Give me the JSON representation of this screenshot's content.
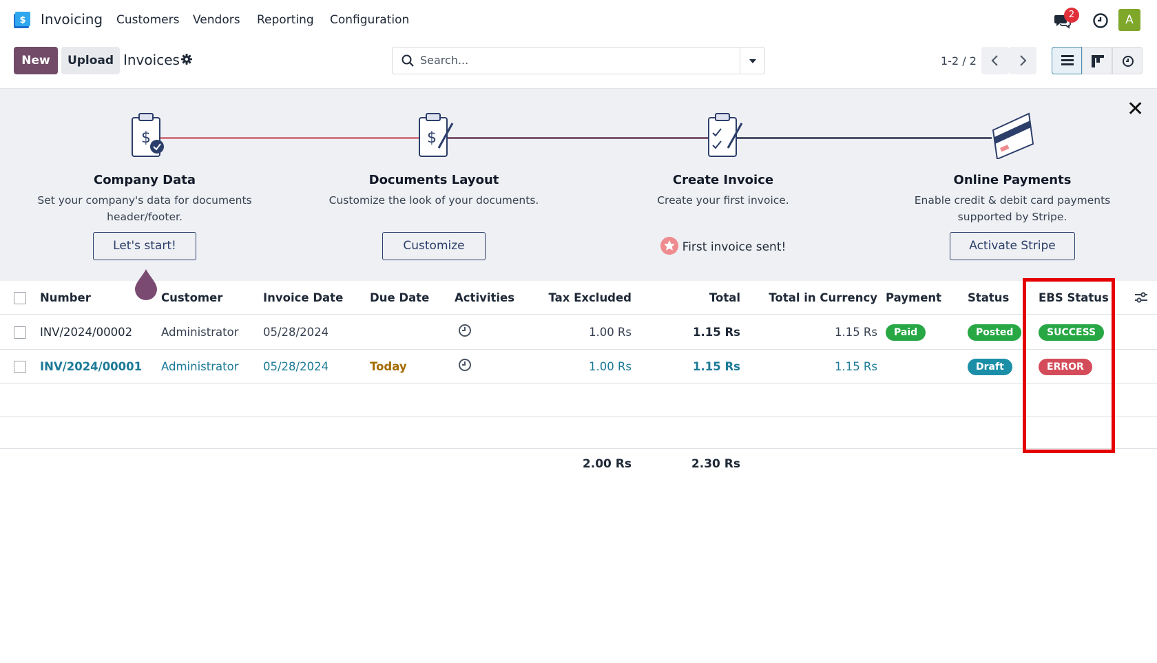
{
  "app": {
    "name": "Invoicing",
    "menu": [
      "Customers",
      "Vendors",
      "Reporting",
      "Configuration"
    ],
    "notification_count": "2",
    "user_initial": "A"
  },
  "control_panel": {
    "new_label": "New",
    "upload_label": "Upload",
    "title": "Invoices",
    "search_placeholder": "Search...",
    "pager": "1-2 / 2"
  },
  "onboarding": {
    "steps": [
      {
        "title": "Company Data",
        "desc": "Set your company's data for documents header/footer.",
        "button": "Let's start!"
      },
      {
        "title": "Documents Layout",
        "desc": "Customize the look of your documents.",
        "button": "Customize"
      },
      {
        "title": "Create Invoice",
        "desc": "Create your first invoice.",
        "done": "First invoice sent!"
      },
      {
        "title": "Online Payments",
        "desc": "Enable credit & debit card payments supported by Stripe.",
        "button": "Activate Stripe"
      }
    ]
  },
  "table": {
    "columns": [
      "Number",
      "Customer",
      "Invoice Date",
      "Due Date",
      "Activities",
      "Tax Excluded",
      "Total",
      "Total in Currency",
      "Payment",
      "Status",
      "EBS Status"
    ],
    "rows": [
      {
        "number": "INV/2024/00002",
        "customer": "Administrator",
        "invoice_date": "05/28/2024",
        "due_date": "",
        "tax_excluded": "1.00 Rs",
        "total": "1.15 Rs",
        "total_currency": "1.15 Rs",
        "payment": "Paid",
        "status": "Posted",
        "ebs_status": "SUCCESS"
      },
      {
        "number": "INV/2024/00001",
        "customer": "Administrator",
        "invoice_date": "05/28/2024",
        "due_date": "Today",
        "tax_excluded": "1.00 Rs",
        "total": "1.15 Rs",
        "total_currency": "1.15 Rs",
        "payment": "",
        "status": "Draft",
        "ebs_status": "ERROR"
      }
    ],
    "totals": {
      "tax_excluded": "2.00 Rs",
      "total": "2.30 Rs"
    }
  },
  "colors": {
    "brand": "#714b67",
    "success": "#28a745",
    "teal": "#1c8fa8",
    "error": "#d44c59",
    "link": "#1c7a97",
    "highlight": "#e50000"
  }
}
